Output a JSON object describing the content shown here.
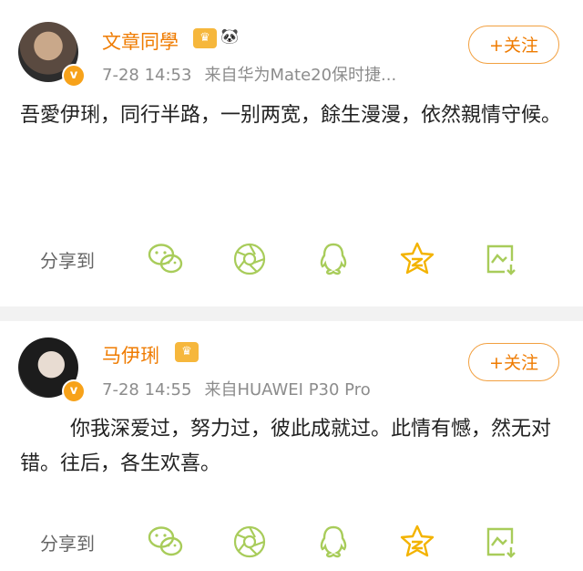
{
  "posts": [
    {
      "name": "文章同學",
      "time": "7-28 14:53",
      "source": "来自华为Mate20保时捷...",
      "follow_label": "+关注",
      "text": "吾愛伊琍，同行半路，一别两宽，餘生漫漫，依然親情守候。",
      "share_label": "分享到"
    },
    {
      "name": "马伊琍",
      "time": "7-28 14:55",
      "source": "来自HUAWEI P30 Pro",
      "follow_label": "+关注",
      "text": "你我深爱过，努力过，彼此成就过。此情有憾，然无对错。往后，各生欢喜。",
      "share_label": "分享到"
    }
  ],
  "share_icons": [
    "wechat-icon",
    "moments-icon",
    "qq-icon",
    "qzone-star-icon",
    "save-image-icon"
  ],
  "colors": {
    "accent": "#ef7b00",
    "icon": "#a8cc5a",
    "meta": "#8c8c8c",
    "divider": "#f2f2f2"
  }
}
